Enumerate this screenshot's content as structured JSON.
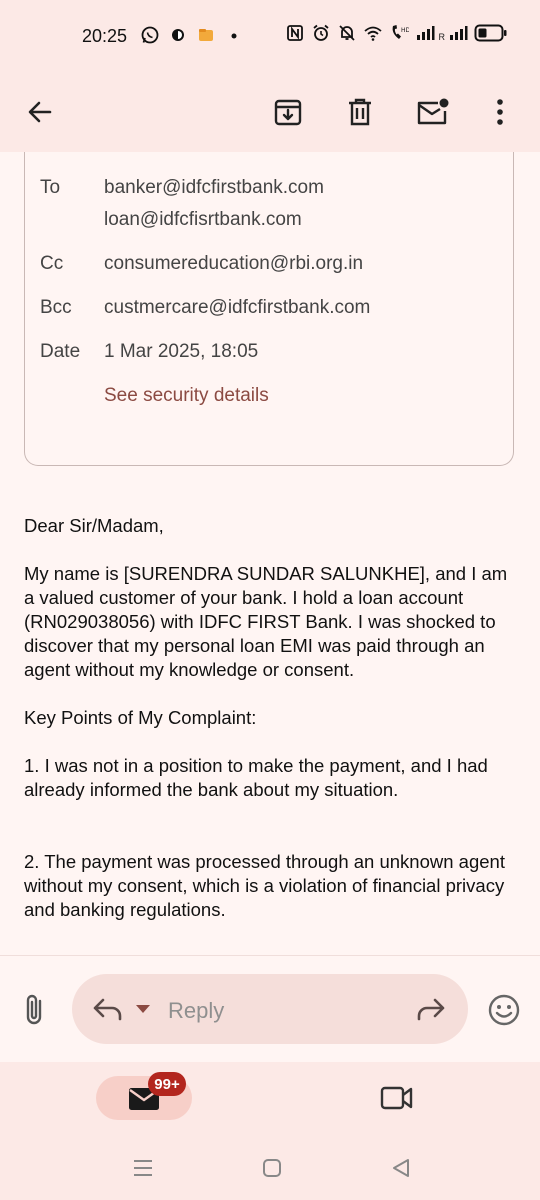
{
  "status_bar": {
    "time": "20:25",
    "signal_label": "R",
    "left_icons": [
      "whatsapp-icon",
      "app-icon",
      "folder-icon",
      "dot-icon"
    ],
    "right_icons": [
      "nfc-icon",
      "alarm-icon",
      "mute-icon",
      "wifi-icon",
      "volte-icon",
      "signal-icon",
      "signal-roaming-icon",
      "battery-icon"
    ]
  },
  "toolbar": {
    "icons": [
      "back-arrow-icon",
      "archive-icon",
      "delete-icon",
      "mark-unread-icon",
      "more-vert-icon"
    ]
  },
  "details": {
    "to_label": "To",
    "to_values": [
      "banker@idfcfirstbank.com",
      "loan@idfcfisrtbank.com"
    ],
    "cc_label": "Cc",
    "cc_value": "consumereducation@rbi.org.in",
    "bcc_label": "Bcc",
    "bcc_value": "custmercare@idfcfirstbank.com",
    "date_label": "Date",
    "date_value": "1 Mar 2025, 18:05",
    "security_link": "See security details"
  },
  "message": {
    "greeting": "Dear Sir/Madam,",
    "para1": "My name is [SURENDRA SUNDAR SALUNKHE], and I am a valued customer of your bank. I hold a loan account (RN029038056) with IDFC FIRST Bank. I was shocked to discover that my personal loan EMI was paid through an agent without my knowledge or consent.",
    "key_points_heading": "Key Points of My Complaint:",
    "point1": "1. I was not in a position to make the payment, and I had already informed the bank about my situation.",
    "point2": "2. The payment was processed through an unknown agent without my consent, which is a violation of financial privacy and banking regulations."
  },
  "reply_bar": {
    "reply_placeholder": "Reply"
  },
  "bottom_nav": {
    "mail_badge": "99+"
  },
  "colors": {
    "accent": "#8B4A42",
    "surface": "#FFF5F3",
    "bar": "#FCE9E6",
    "badge": "#B3261E"
  }
}
